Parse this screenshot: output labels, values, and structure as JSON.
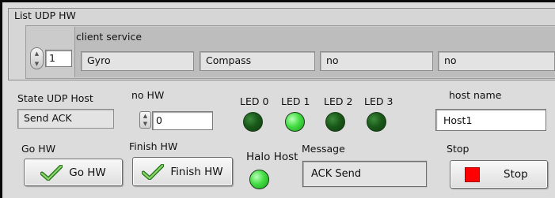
{
  "list_cluster": {
    "title": "List UDP HW",
    "array_index": "1",
    "element_label": "client service",
    "items": [
      "Gyro",
      "Compass",
      "no",
      "no"
    ]
  },
  "state_udp_host": {
    "label": "State UDP Host",
    "value": "Send ACK"
  },
  "no_hw": {
    "label": "no HW",
    "value": "0"
  },
  "leds": [
    {
      "label": "LED 0",
      "state": "off"
    },
    {
      "label": "LED 1",
      "state": "on"
    },
    {
      "label": "LED 2",
      "state": "off"
    },
    {
      "label": "LED 3",
      "state": "off"
    }
  ],
  "host_name": {
    "label": "host name",
    "value": "Host1"
  },
  "go_hw": {
    "label": "Go HW",
    "button_text": "Go HW"
  },
  "finish_hw": {
    "label": "Finish HW",
    "button_text": "Finish HW"
  },
  "halo_host": {
    "label": "Halo Host",
    "state": "on"
  },
  "message": {
    "label": "Message",
    "value": "ACK Send"
  },
  "stop": {
    "label": "Stop",
    "button_text": "Stop",
    "icon_color": "#ff0000"
  },
  "icons": [
    "spinner-arrows-icon",
    "checkmark-icon",
    "stop-square-icon"
  ]
}
